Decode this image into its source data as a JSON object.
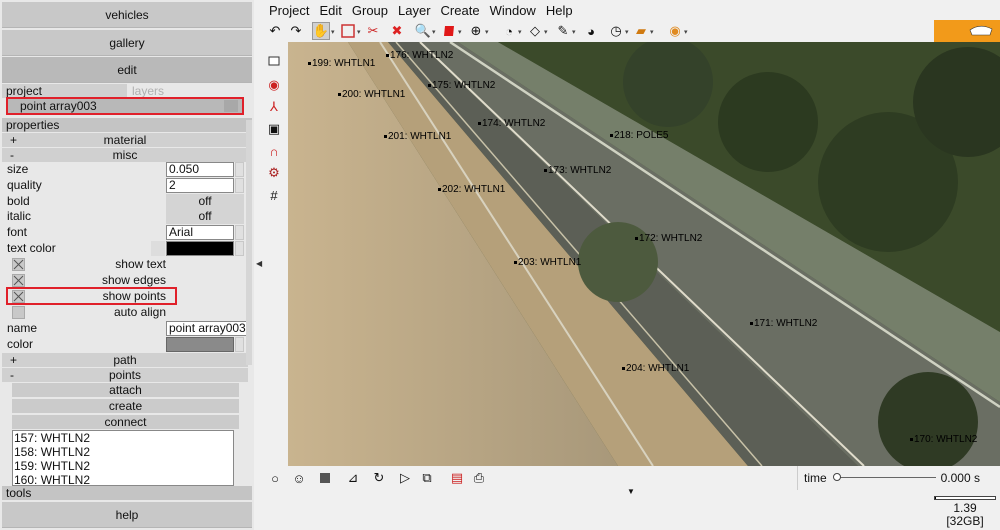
{
  "left": {
    "nav": {
      "vehicles": "vehicles",
      "gallery": "gallery",
      "edit": "edit",
      "tools": "tools",
      "help": "help"
    },
    "tabs": {
      "project": "project",
      "layers": "layers"
    },
    "project_item": "point array003",
    "properties_header": "properties",
    "groups": {
      "material": "material",
      "misc": "misc",
      "path": "path",
      "points": "points"
    },
    "expand": {
      "plus": "+",
      "minus": "-"
    },
    "props": {
      "size": {
        "label": "size",
        "value": "0.050"
      },
      "quality": {
        "label": "quality",
        "value": "2"
      },
      "bold": {
        "label": "bold",
        "value": "off"
      },
      "italic": {
        "label": "italic",
        "value": "off"
      },
      "font": {
        "label": "font",
        "value": "Arial"
      },
      "text_color": {
        "label": "text color"
      },
      "name": {
        "label": "name",
        "value": "point array003"
      },
      "color": {
        "label": "color"
      }
    },
    "checks": {
      "show_text": "show text",
      "show_edges": "show edges",
      "show_points": "show points",
      "auto_align": "auto align"
    },
    "actions": {
      "attach": "attach",
      "create": "create",
      "connect": "connect"
    },
    "points_list": [
      "157: WHTLN2",
      "158: WHTLN2",
      "159: WHTLN2",
      "160: WHTLN2"
    ]
  },
  "menu": [
    "Project",
    "Edit",
    "Group",
    "Layer",
    "Create",
    "Window",
    "Help"
  ],
  "map_labels": [
    "176: WHTLN2",
    "199: WHTLN1",
    "175: WHTLN2",
    "200: WHTLN1",
    "174: WHTLN2",
    "201: WHTLN1",
    "218: POLE5",
    "173: WHTLN2",
    "202: WHTLN1",
    "172: WHTLN2",
    "203: WHTLN1",
    "171: WHTLN2",
    "204: WHTLN1",
    "170: WHTLN2"
  ],
  "status": {
    "time_label": "time",
    "time_value": "0.000 s",
    "zoom": "1.39",
    "memory": "[32GB]"
  },
  "colors": {
    "highlight": "#e0202a",
    "logo": "#f29a1a",
    "text_color_swatch": "#000000",
    "color_swatch": "#8a8a8a"
  }
}
